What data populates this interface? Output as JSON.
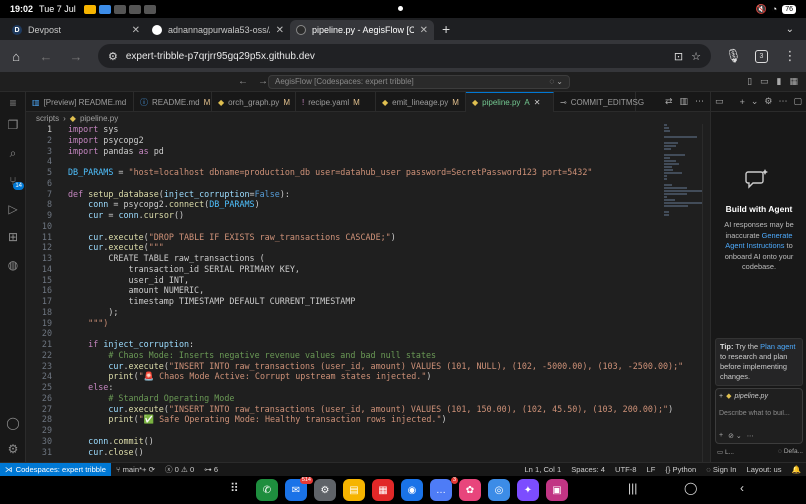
{
  "status_bar": {
    "time": "19:02",
    "date": "Tue 7 Jul",
    "battery": "76"
  },
  "browser": {
    "tabs": [
      {
        "title": "Devpost",
        "icon": "D",
        "active": false
      },
      {
        "title": "adnannagpurwala53-oss/A...",
        "icon": "github-icon",
        "active": false
      },
      {
        "title": "pipeline.py - AegisFlow [Co...",
        "icon": "codespaces-icon",
        "active": true
      }
    ],
    "url": "expert-tribble-p7qrjrr95gq29p5x.github.dev",
    "tab_count": "3"
  },
  "vscode": {
    "command_center": "AegisFlow [Codespaces: expert tribble]",
    "editor_tabs": [
      {
        "label": "[Preview] README.md",
        "icon": "preview-icon",
        "mod": ""
      },
      {
        "label": "README.md",
        "icon": "info-icon",
        "mod": "M"
      },
      {
        "label": "orch_graph.py",
        "icon": "python-icon",
        "mod": "M"
      },
      {
        "label": "recipe.yaml",
        "icon": "yaml-icon",
        "mod": "M"
      },
      {
        "label": "emit_lineage.py",
        "icon": "python-icon",
        "mod": "M"
      },
      {
        "label": "pipeline.py",
        "icon": "python-icon",
        "mod": "A",
        "active": true
      },
      {
        "label": "COMMIT_EDITMSG",
        "icon": "git-icon",
        "mod": ""
      }
    ],
    "breadcrumb": [
      "scripts",
      "pipeline.py"
    ],
    "code_lines": [
      {
        "n": "1",
        "t": "import sys"
      },
      {
        "n": "2",
        "t": "import psycopg2"
      },
      {
        "n": "3",
        "t": "import pandas as pd"
      },
      {
        "n": "4",
        "t": ""
      },
      {
        "n": "5",
        "t": "DB_PARAMS = \"host=localhost dbname=production_db user=datahub_user password=SecretPassword123 port=5432\""
      },
      {
        "n": "6",
        "t": ""
      },
      {
        "n": "7",
        "t": "def setup_database(inject_corruption=False):"
      },
      {
        "n": "8",
        "t": "    conn = psycopg2.connect(DB_PARAMS)"
      },
      {
        "n": "9",
        "t": "    cur = conn.cursor()"
      },
      {
        "n": "10",
        "t": ""
      },
      {
        "n": "11",
        "t": "    cur.execute(\"DROP TABLE IF EXISTS raw_transactions CASCADE;\")"
      },
      {
        "n": "12",
        "t": "    cur.execute(\"\"\""
      },
      {
        "n": "13",
        "t": "        CREATE TABLE raw_transactions ("
      },
      {
        "n": "14",
        "t": "            transaction_id SERIAL PRIMARY KEY,"
      },
      {
        "n": "15",
        "t": "            user_id INT,"
      },
      {
        "n": "16",
        "t": "            amount NUMERIC,"
      },
      {
        "n": "17",
        "t": "            timestamp TIMESTAMP DEFAULT CURRENT_TIMESTAMP"
      },
      {
        "n": "18",
        "t": "        );"
      },
      {
        "n": "19",
        "t": "    \"\"\")"
      },
      {
        "n": "20",
        "t": ""
      },
      {
        "n": "21",
        "t": "    if inject_corruption:"
      },
      {
        "n": "22",
        "t": "        # Chaos Mode: Inserts negative revenue values and bad null states"
      },
      {
        "n": "23",
        "t": "        cur.execute(\"INSERT INTO raw_transactions (user_id, amount) VALUES (101, NULL), (102, -5000.00), (103, -2500.00);\""
      },
      {
        "n": "24",
        "t": "        print(\"🚨 Chaos Mode Active: Corrupt upstream states injected.\")"
      },
      {
        "n": "25",
        "t": "    else:"
      },
      {
        "n": "26",
        "t": "        # Standard Operating Mode"
      },
      {
        "n": "27",
        "t": "        cur.execute(\"INSERT INTO raw_transactions (user_id, amount) VALUES (101, 150.00), (102, 45.50), (103, 200.00);\")"
      },
      {
        "n": "28",
        "t": "        print(\"✅ Safe Operating Mode: Healthy transaction rows injected.\")"
      },
      {
        "n": "29",
        "t": ""
      },
      {
        "n": "30",
        "t": "    conn.commit()"
      },
      {
        "n": "31",
        "t": "    cur.close()"
      }
    ],
    "chat": {
      "title": "Build with Agent",
      "text_before": "AI responses may be inaccurate",
      "link": "Generate Agent Instructions",
      "text_after": "to onboard AI onto your codebase.",
      "tip_label": "Tip:",
      "tip_pre": "Try the",
      "tip_link": "Plan agent",
      "tip_post": "to research and plan before implementing changes.",
      "context_chip": "pipeline.py",
      "placeholder": "Describe what to buil...",
      "footer_left": "L...",
      "footer_right": "Defa..."
    },
    "status": {
      "remote": "Codespaces: expert tribble",
      "branch": "main*+",
      "errors": "0",
      "warnings": "0",
      "ports": "6",
      "position": "Ln 1, Col 1",
      "spaces": "Spaces: 4",
      "encoding": "UTF-8",
      "eol": "LF",
      "language": "Python",
      "sign_in": "Sign In",
      "layout": "Layout: us"
    }
  },
  "android_nav": {
    "dock": [
      {
        "name": "phone-app",
        "color": "#1e8e3e",
        "glyph": "✆",
        "count": ""
      },
      {
        "name": "messages-app",
        "color": "#1a73e8",
        "glyph": "✉",
        "count": "514"
      },
      {
        "name": "settings-app",
        "color": "#5f6368",
        "glyph": "⚙",
        "count": ""
      },
      {
        "name": "files-app",
        "color": "#f6b400",
        "glyph": "▤",
        "count": ""
      },
      {
        "name": "flipboard-app",
        "color": "#e12828",
        "glyph": "▦",
        "count": ""
      },
      {
        "name": "chat-app",
        "color": "#1a73e8",
        "glyph": "◉",
        "count": ""
      },
      {
        "name": "messenger-app",
        "color": "#4e7cf6",
        "glyph": "…",
        "count": "3"
      },
      {
        "name": "photos-app",
        "color": "#e8457c",
        "glyph": "✿",
        "count": ""
      },
      {
        "name": "chrome-app",
        "color": "#3c8ce7",
        "glyph": "◎",
        "count": ""
      },
      {
        "name": "gemini-app",
        "color": "#7c4dff",
        "glyph": "✦",
        "count": ""
      },
      {
        "name": "gallery-app",
        "color": "#c13584",
        "glyph": "▣",
        "count": ""
      }
    ]
  }
}
